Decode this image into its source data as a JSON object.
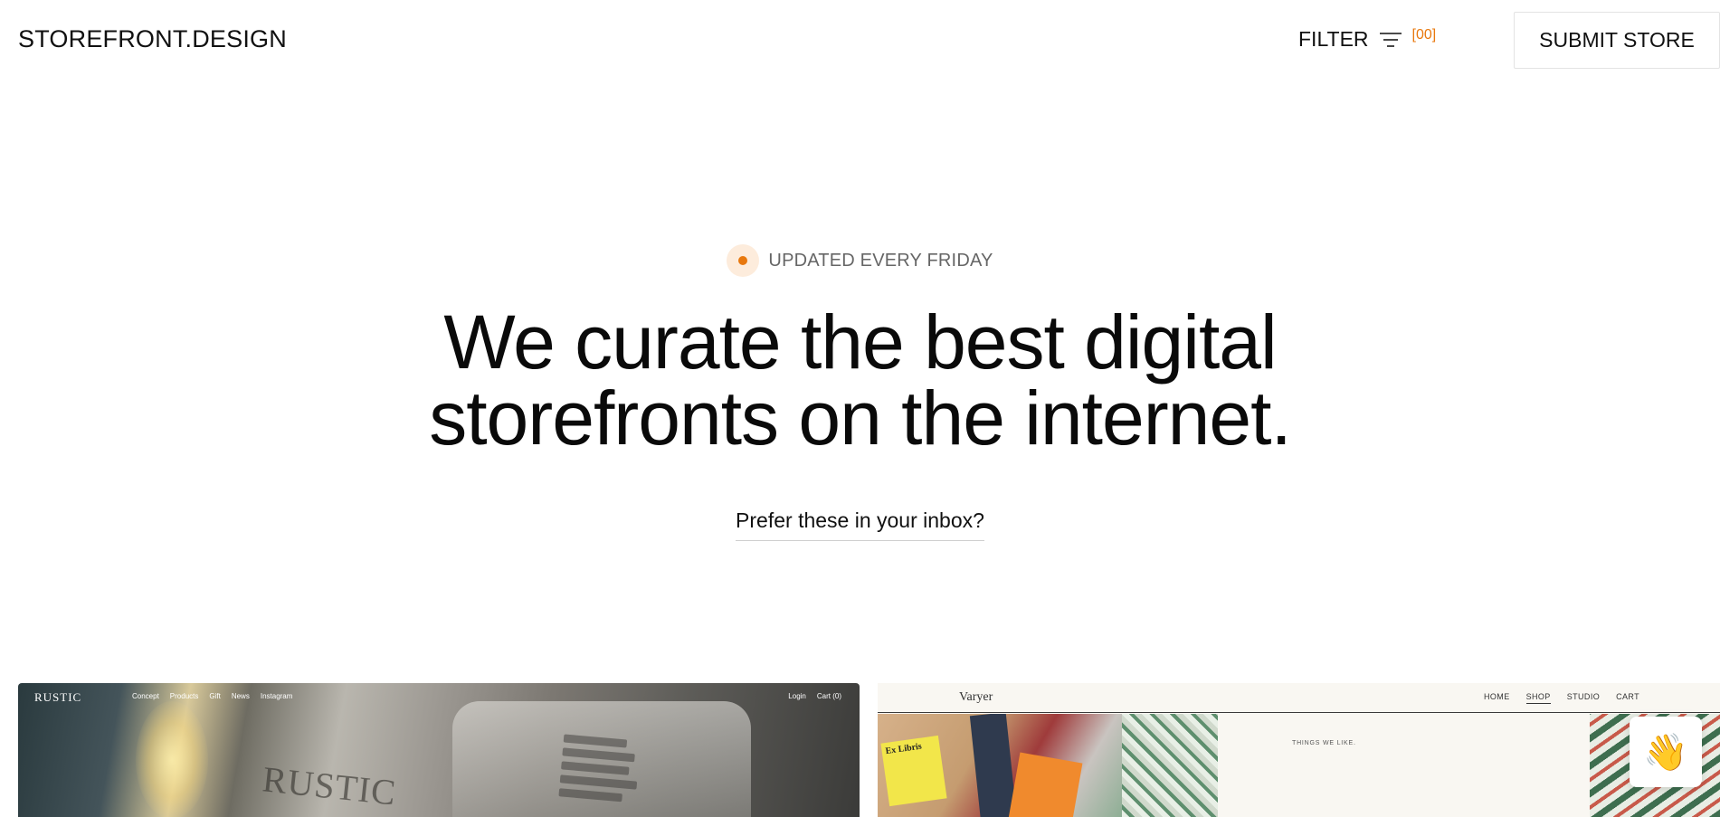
{
  "header": {
    "logo": "STOREFRONT.DESIGN",
    "filter_label": "FILTER",
    "filter_count": "[00]",
    "submit_label": "SUBMIT STORE"
  },
  "hero": {
    "badge": "UPDATED EVERY FRIDAY",
    "headline_line1": "We curate the best digital",
    "headline_line2": "storefronts on the internet.",
    "inbox_link": "Prefer these in your inbox?"
  },
  "colors": {
    "accent": "#e8780e",
    "text": "#111111"
  },
  "cards": [
    {
      "brand": "RUSTIC",
      "nav": [
        "Concept",
        "Products",
        "Gift",
        "News",
        "Instagram"
      ],
      "nav_right": [
        "Login",
        "Cart (0)"
      ],
      "product_text": "RUSTIC"
    },
    {
      "brand": "Varyer",
      "nav": [
        "HOME",
        "SHOP",
        "STUDIO",
        "CART"
      ],
      "active_nav": "SHOP",
      "tagline": "THINGS WE LIKE.",
      "sticker_text": "Ex Libris"
    }
  ],
  "chat_widget": {
    "icon": "waving-hand-icon",
    "glyph": "👋"
  }
}
